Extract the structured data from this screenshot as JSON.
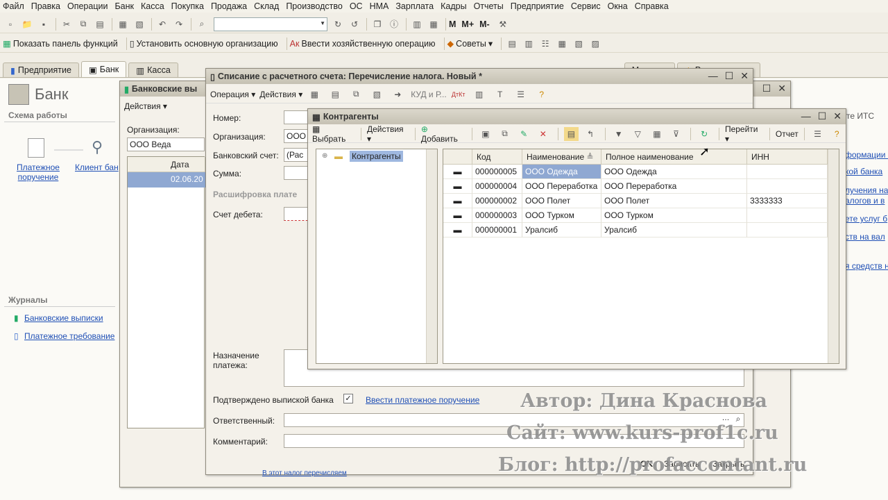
{
  "menu": [
    "Файл",
    "Правка",
    "Операции",
    "Банк",
    "Касса",
    "Покупка",
    "Продажа",
    "Склад",
    "Производство",
    "ОС",
    "НМА",
    "Зарплата",
    "Кадры",
    "Отчеты",
    "Предприятие",
    "Сервис",
    "Окна",
    "Справка"
  ],
  "toolbar2": {
    "show_panel": "Показать панель функций",
    "set_org": "Установить основную организацию",
    "enter_op": "Ввести хозяйственную операцию",
    "tips": "Советы"
  },
  "tabs": [
    "Предприятие",
    "Банк",
    "Касса",
    "",
    "",
    "",
    "",
    "",
    "",
    "Монитор",
    "Руководителю"
  ],
  "bank_panel": {
    "title": "Банк",
    "scheme": "Схема работы",
    "pay_order": "Платежное поручение",
    "client_bank": "Клиент бан",
    "journals": "Журналы",
    "bank_statements": "Банковские выписки",
    "pay_request": "Платежное требование"
  },
  "statements_win": {
    "title": "Банковские вы",
    "actions": "Действия",
    "org_label": "Организация:",
    "org_value": "ООО Веда",
    "col_date": "Дата",
    "row_date": "02.06.20"
  },
  "writeoff_win": {
    "title": "Списание с расчетного счета: Перечисление налога. Новый *",
    "menu_operation": "Операция",
    "menu_actions": "Действия",
    "kud": "КУД и Р...",
    "number_label": "Номер:",
    "org_label": "Организация:",
    "org_value": "ООО",
    "account_label": "Банковский счет:",
    "account_value": "(Рас",
    "sum_label": "Сумма:",
    "decode_label": "Расшифровка плате",
    "debit_label": "Счет дебета:",
    "purpose_label": "Назначение платежа:",
    "confirmed_label": "Подтверждено выпиской банка",
    "enter_order": "Ввести платежное поручение",
    "responsible_label": "Ответственный:",
    "comment_label": "Комментарий:",
    "ok": "OK",
    "write": "Записать",
    "close": "Закрыть",
    "bottom_link": "В этот налог перечисляем"
  },
  "right_panel": [
    "те ИТС",
    "формации с",
    "кой банка",
    "лучения на",
    "алогов и в",
    "ете услуг б",
    "ств на вал",
    "я средств н"
  ],
  "contractors": {
    "title": "Контрагенты",
    "toolbar": {
      "select": "Выбрать",
      "actions": "Действия",
      "add": "Добавить",
      "goto": "Перейти",
      "report": "Отчет"
    },
    "tree_root": "Контрагенты",
    "columns": [
      "Код",
      "Наименование",
      "Полное наименование",
      "ИНН"
    ],
    "rows": [
      {
        "code": "000000005",
        "name": "ООО Одежда",
        "full": "ООО Одежда",
        "inn": ""
      },
      {
        "code": "000000004",
        "name": "ООО Переработка",
        "full": "ООО Переработка",
        "inn": ""
      },
      {
        "code": "000000002",
        "name": "ООО Полет",
        "full": "ООО Полет",
        "inn": "3333333"
      },
      {
        "code": "000000003",
        "name": "ООО Турком",
        "full": "ООО Турком",
        "inn": ""
      },
      {
        "code": "000000001",
        "name": "Уралсиб",
        "full": "Уралсиб",
        "inn": ""
      }
    ]
  },
  "watermark": {
    "author": "Автор: Дина Краснова",
    "site": "Сайт: www.kurs-prof1c.ru",
    "blog": "Блог: http://profaccontant.ru"
  },
  "colors": {
    "selection": "#9fb8e0",
    "link": "#1f4fb5"
  }
}
